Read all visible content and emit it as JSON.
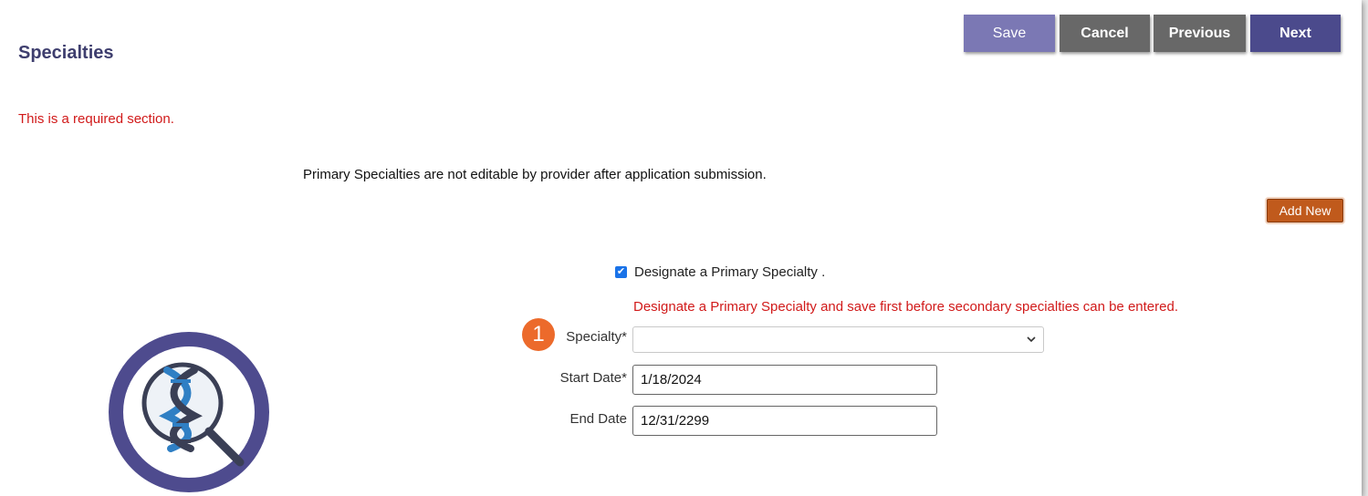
{
  "header": {
    "title": "Specialties"
  },
  "toolbar": {
    "save_label": "Save",
    "cancel_label": "Cancel",
    "previous_label": "Previous",
    "next_label": "Next"
  },
  "messages": {
    "required": "This is a required section.",
    "notice": "Primary Specialties are not editable by provider after application submission.",
    "warning": "Designate a Primary Specialty and save first before secondary specialties can be entered."
  },
  "add_new_label": "Add New",
  "primary_checkbox": {
    "label": "Designate a Primary Specialty .",
    "checked": true
  },
  "step_badge": "1",
  "form": {
    "specialty_label": "Specialty*",
    "specialty_value": "",
    "start_date_label": "Start Date*",
    "start_date_value": "1/18/2024",
    "end_date_label": "End Date",
    "end_date_value": "12/31/2299"
  },
  "icons": {
    "emblem": "dna-magnifier-icon",
    "dropdown": "chevron-down-icon",
    "check": "checkmark-icon"
  },
  "colors": {
    "title": "#3e3e6e",
    "error": "#d11a1a",
    "save": "#7b78b4",
    "cancel": "#686868",
    "previous": "#686868",
    "next": "#4b4a8c",
    "add_new": "#c05a1c",
    "badge": "#ec6a2b",
    "emblem_ring": "#4e4b8e",
    "dna_blue": "#2f7fc4"
  }
}
